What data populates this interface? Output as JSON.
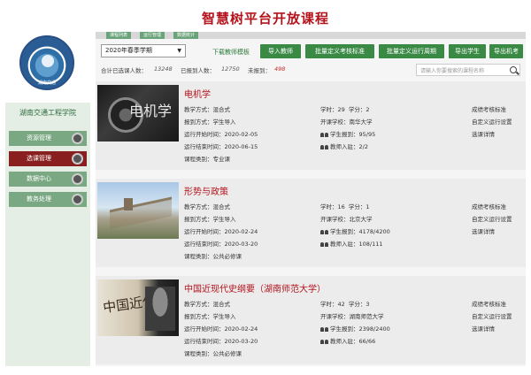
{
  "page": {
    "title": "智慧树平台开放课程"
  },
  "sidebar": {
    "school_name": "湖南交通工程学院",
    "logo_text": "湖南交通",
    "items": [
      {
        "label": "资源管理",
        "active": false
      },
      {
        "label": "选课管理",
        "active": true
      },
      {
        "label": "数据中心",
        "active": false
      },
      {
        "label": "教务处理",
        "active": false
      }
    ]
  },
  "tabs": [
    {
      "label": "课程列表"
    },
    {
      "label": "运行管理"
    },
    {
      "label": "数据统计"
    }
  ],
  "toolbar": {
    "semester": "2020年春季学期",
    "download_link": "下载教师模板",
    "buttons": [
      "导入教师",
      "批量定义考核标准",
      "批量定义运行周期",
      "导出学生",
      "导出机考"
    ]
  },
  "stats": {
    "selected_label": "合计已选课人数：",
    "selected_value": "13248",
    "reported_label": "已报到人数：",
    "reported_value": "12750",
    "unreported_label": "未报到：",
    "unreported_value": "498",
    "search_placeholder": "请输入你要搜索的课程名称"
  },
  "labels": {
    "teaching_mode": "教学方式：",
    "report_mode": "报到方式：",
    "start_time": "运行开始时间：",
    "end_time": "运行结束时间：",
    "category": "课程类别：",
    "hours": "学时：",
    "credits": "学分：",
    "school": "开课学校：",
    "students": "学生报到：",
    "teachers": "教师入驻："
  },
  "actions": [
    "成绩考核标准",
    "自定义运行设置",
    "选课详情"
  ],
  "courses": [
    {
      "title": "电机学",
      "thumb_text": "电机学",
      "teaching_mode": "混合式",
      "report_mode": "学生导入",
      "start_time": "2020-02-05",
      "end_time": "2020-06-15",
      "category": "专业课",
      "hours": "29",
      "credits": "2",
      "school": "南华大学",
      "students": "95/95",
      "teachers": "2/2"
    },
    {
      "title": "形势与政策",
      "thumb_text": "",
      "teaching_mode": "混合式",
      "report_mode": "学生导入",
      "start_time": "2020-02-24",
      "end_time": "2020-03-20",
      "category": "公共必修课",
      "hours": "16",
      "credits": "1",
      "school": "北京大学",
      "students": "4178/4200",
      "teachers": "108/111"
    },
    {
      "title": "中国近现代史纲要（湖南师范大学）",
      "thumb_text": "中国近代史",
      "teaching_mode": "混合式",
      "report_mode": "学生导入",
      "start_time": "2020-02-24",
      "end_time": "2020-03-20",
      "category": "公共必修课",
      "hours": "42",
      "credits": "3",
      "school": "湖南师范大学",
      "students": "2398/2400",
      "teachers": "66/66"
    }
  ],
  "colors": {
    "title_red": "#b4131c",
    "button_green": "#3a8a46",
    "nav_active": "#8a1f1f",
    "nav_normal": "#7aa882"
  }
}
